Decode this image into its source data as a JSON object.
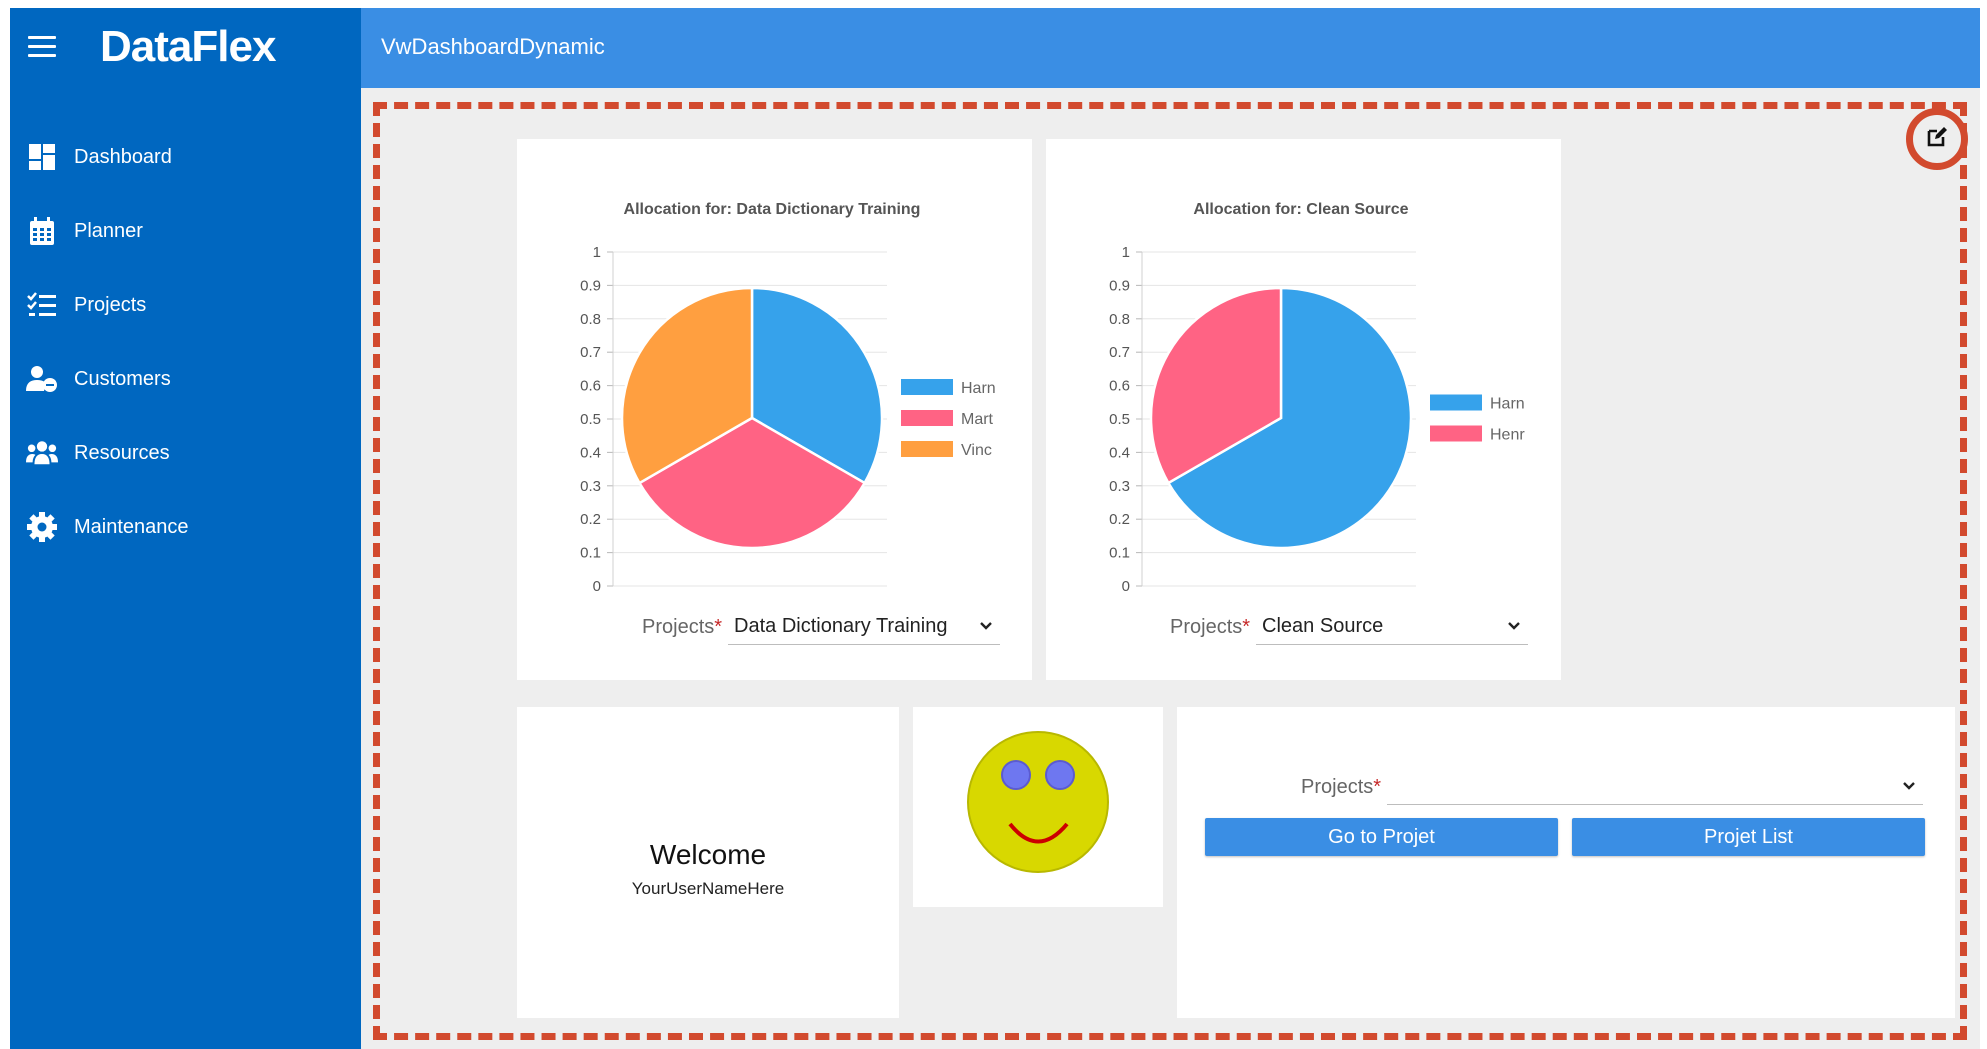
{
  "app": {
    "brand": "DataFlex",
    "header_title": "VwDashboardDynamic"
  },
  "sidebar": {
    "items": [
      {
        "label": "Dashboard",
        "icon": "dashboard-icon"
      },
      {
        "label": "Planner",
        "icon": "calendar-icon"
      },
      {
        "label": "Projects",
        "icon": "checklist-icon"
      },
      {
        "label": "Customers",
        "icon": "customers-icon"
      },
      {
        "label": "Resources",
        "icon": "people-icon"
      },
      {
        "label": "Maintenance",
        "icon": "gear-icon"
      }
    ]
  },
  "colors": {
    "sidebar": "#0067c0",
    "header": "#3a8ee4",
    "highlight": "#d24a2e",
    "blue": "#36a2eb",
    "pink": "#ff6384",
    "orange": "#ff9f40"
  },
  "chart_data": [
    {
      "type": "pie",
      "title": "Allocation for: Data Dictionary Training",
      "yticks": [
        "1",
        "0.9",
        "0.8",
        "0.7",
        "0.6",
        "0.5",
        "0.4",
        "0.3",
        "0.2",
        "0.1",
        "0"
      ],
      "legend": [
        "Harn",
        "Mart",
        "Vinc"
      ],
      "values": [
        0.3333,
        0.3333,
        0.3334
      ],
      "colors": [
        "#36a2eb",
        "#ff6384",
        "#ff9f40"
      ]
    },
    {
      "type": "pie",
      "title": "Allocation for: Clean Source",
      "yticks": [
        "1",
        "0.9",
        "0.8",
        "0.7",
        "0.6",
        "0.5",
        "0.4",
        "0.3",
        "0.2",
        "0.1",
        "0"
      ],
      "legend": [
        "Harn",
        "Henr"
      ],
      "values": [
        0.6667,
        0.3333
      ],
      "colors": [
        "#36a2eb",
        "#ff6384"
      ]
    }
  ],
  "chart_selects": [
    {
      "label": "Projects",
      "required": "*",
      "value": "Data Dictionary Training"
    },
    {
      "label": "Projects",
      "required": "*",
      "value": "Clean Source"
    }
  ],
  "welcome": {
    "title": "Welcome",
    "user": "YourUserNameHere"
  },
  "project_nav": {
    "label": "Projects",
    "required": "*",
    "value": "",
    "go_button": "Go to Projet",
    "list_button": "Projet List"
  }
}
